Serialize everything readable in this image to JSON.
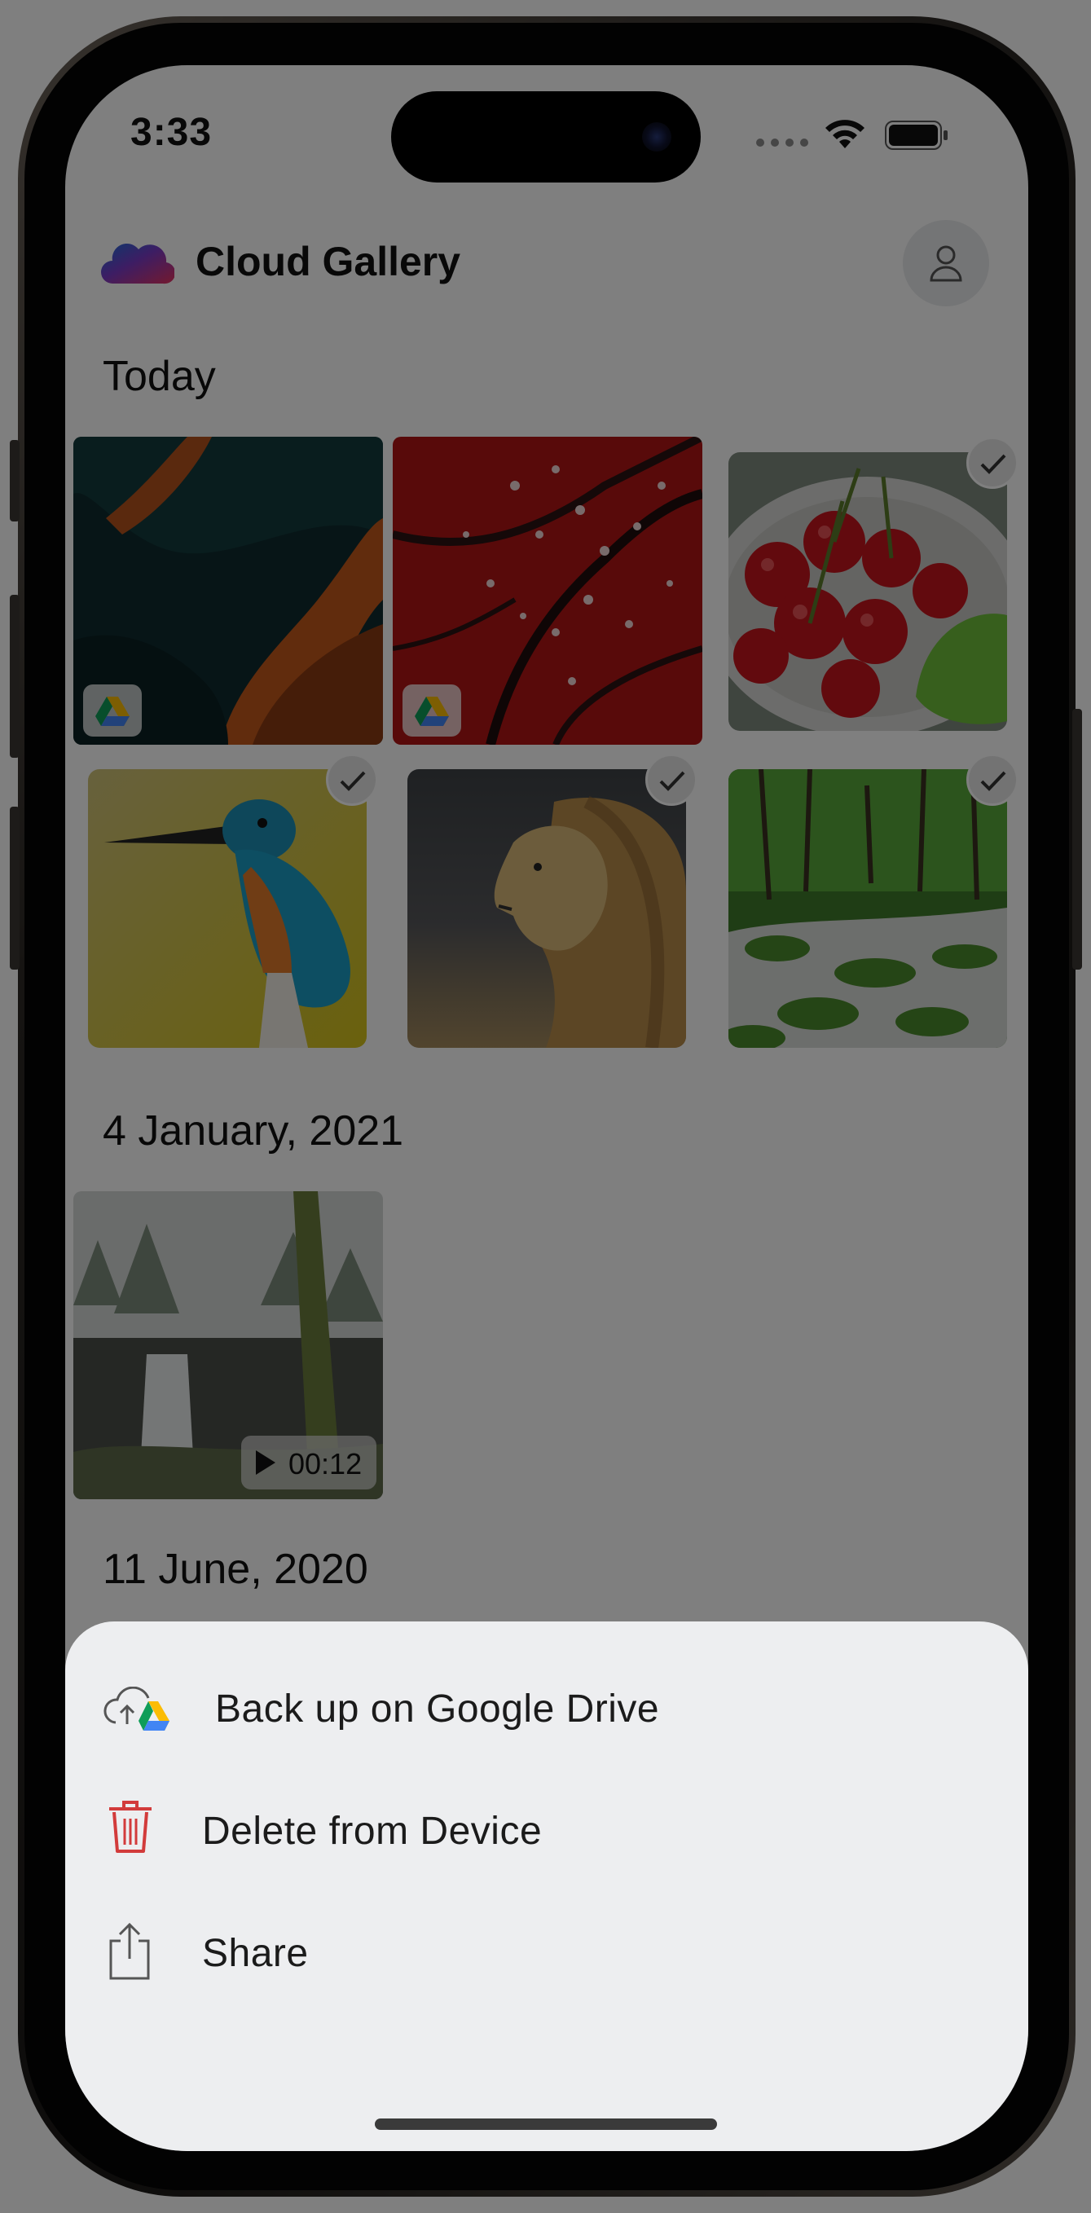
{
  "status_bar": {
    "time": "3:33"
  },
  "header": {
    "title": "Cloud Gallery"
  },
  "sections": [
    {
      "title": "Today"
    },
    {
      "title": "4 January, 2021"
    },
    {
      "title": "11 June, 2020"
    }
  ],
  "photos": {
    "today": [
      {
        "subject": "abstract waves",
        "badge": "google-drive",
        "selected": false
      },
      {
        "subject": "cherry blossom branch",
        "badge": "google-drive",
        "selected": false
      },
      {
        "subject": "cherries in bowl",
        "selected": true
      },
      {
        "subject": "kingfisher bird",
        "selected": true
      },
      {
        "subject": "lion",
        "selected": true
      },
      {
        "subject": "forest stream",
        "selected": true
      }
    ],
    "jan_2021": [
      {
        "subject": "waterfall",
        "type": "video",
        "duration": "00:12"
      }
    ]
  },
  "action_sheet": {
    "items": [
      {
        "label": "Back up on Google Drive",
        "icon": "cloud-upload-drive-icon"
      },
      {
        "label": "Delete from Device",
        "icon": "trash-icon",
        "color": "#d23b3b"
      },
      {
        "label": "Share",
        "icon": "share-icon"
      }
    ]
  },
  "colors": {
    "overlay": "rgba(0,0,0,0.5)",
    "sheet": "#edeef0",
    "delete": "#d23b3b"
  }
}
